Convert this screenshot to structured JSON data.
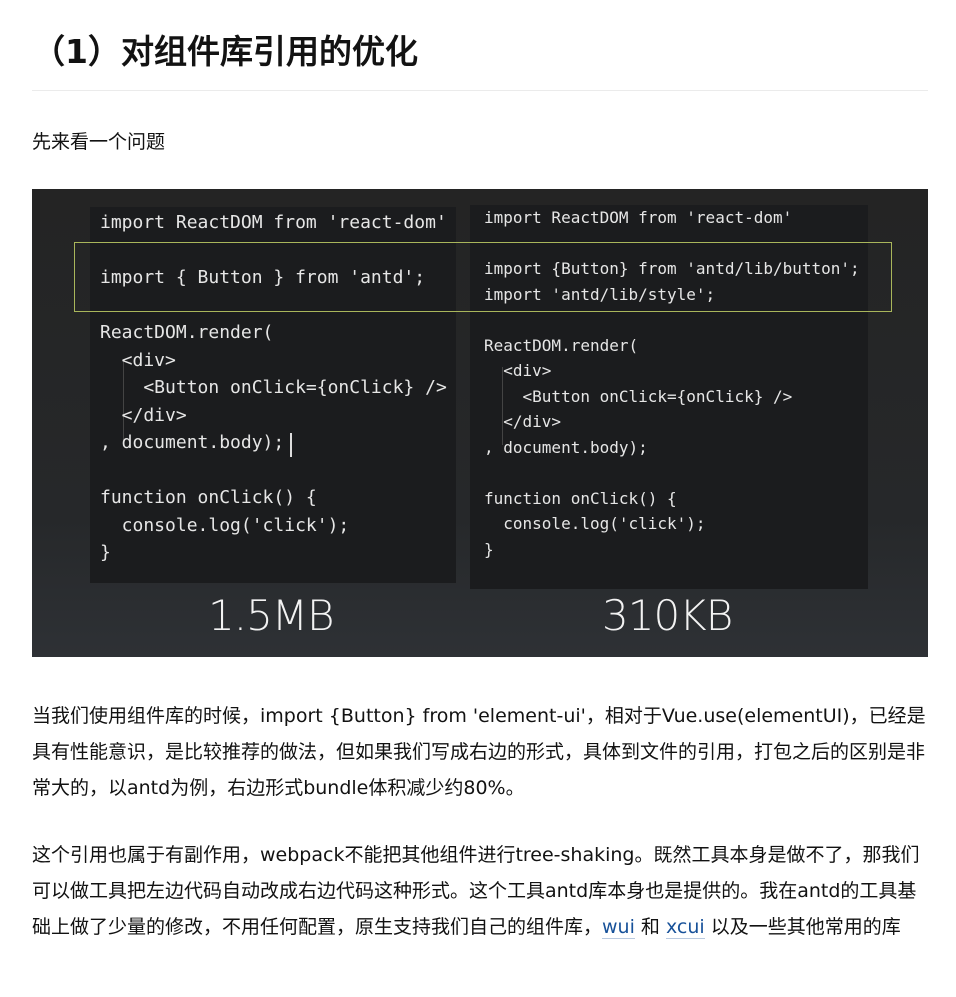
{
  "title": "（1）对组件库引用的优化",
  "intro": "先来看一个问题",
  "figure": {
    "left_code": "import ReactDOM from 'react-dom'\n\nimport { Button } from 'antd';\n\nReactDOM.render(\n  <div>\n    <Button onClick={onClick} />\n  </div>\n, document.body);\n\nfunction onClick() {\n  console.log('click');\n}",
    "right_code": "import ReactDOM from 'react-dom'\n\nimport {Button} from 'antd/lib/button';\nimport 'antd/lib/style';\n\nReactDOM.render(\n  <div>\n    <Button onClick={onClick} />\n  </div>\n, document.body);\n\nfunction onClick() {\n  console.log('click');\n}",
    "left_size": "1.5MB",
    "right_size": "310KB",
    "colors": {
      "highlight_border": "#a9b65b",
      "background": "#242424"
    }
  },
  "para1": "当我们使用组件库的时候，import {Button} from 'element-ui'，相对于Vue.use(elementUI)，已经是具有性能意识，是比较推荐的做法，但如果我们写成右边的形式，具体到文件的引用，打包之后的区别是非常大的，以antd为例，右边形式bundle体积减少约80%。",
  "para2": {
    "text_before": "这个引用也属于有副作用，webpack不能把其他组件进行tree-shaking。既然工具本身是做不了，那我们可以做工具把左边代码自动改成右边代码这种形式。这个工具antd库本身也是提供的。我在antd的工具基础上做了少量的修改，不用任何配置，原生支持我们自己的组件库，",
    "link1": "wui",
    "middle": " 和 ",
    "link2": "xcui",
    "text_after": " 以及一些其他常用的库"
  },
  "colors": {
    "link": "#175199",
    "text": "#121212",
    "divider": "#ebebeb"
  }
}
